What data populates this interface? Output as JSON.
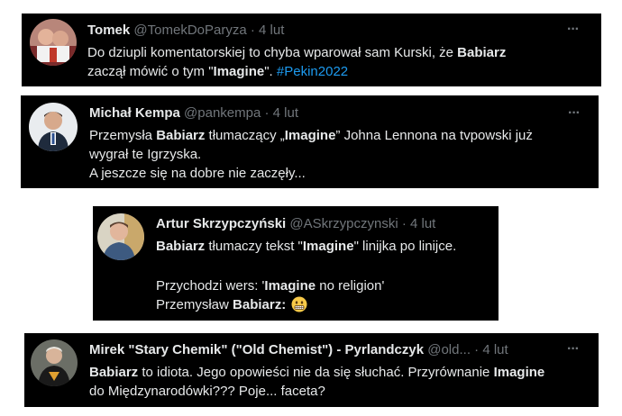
{
  "tweets": [
    {
      "name": "Tomek",
      "handle": "@TomekDoParyza",
      "dot": "·",
      "time": "4 lut",
      "more": "···",
      "line1": {
        "a": "Do dziupli komentatorskiej to chyba wparował sam Kurski, że ",
        "b": "Babiarz"
      },
      "line2": {
        "a": "zaczął mówić o tym \"",
        "b": "Imagine",
        "c": "\". ",
        "hashtag": "#Pekin2022"
      }
    },
    {
      "name": "Michał Kempa",
      "handle": "@pankempa",
      "dot": "·",
      "time": "4 lut",
      "more": "···",
      "line1": {
        "a": "Przemysła ",
        "b": "Babiarz",
        "c": " tłumaczący „",
        "d": "Imagine",
        "e": "” Johna Lennona na tvpowski już"
      },
      "line2": "wygrał te Igrzyska.",
      "line3": "A jeszcze się na dobre nie zaczęły..."
    },
    {
      "name": "Artur Skrzypczyński",
      "handle": "@ASkrzypczynski",
      "dot": "·",
      "time": "4 lut",
      "line1": {
        "b": "Babiarz",
        "a": " tłumaczy tekst \"",
        "d": "Imagine",
        "c": "\" linijka po linijce."
      },
      "line2": {
        "a": "Przychodzi wers: '",
        "b": "Imagine",
        "c": " no religion'"
      },
      "line3": {
        "a": "Przemysław ",
        "b": "Babiarz:",
        "emoji": "grimacing-face"
      }
    },
    {
      "name": "Mirek \"Stary Chemik\" (\"Old Chemist\") - Pyrlandczyk",
      "handle": "@old...",
      "dot": "·",
      "time": "4 lut",
      "more": "···",
      "line1": {
        "b": "Babiarz",
        "a": " to idiota. Jego opowieści nie da się słuchać. Przyrównanie ",
        "d": "Imagine"
      },
      "line2": "do Międzynarodówki??? Poje... faceta?"
    }
  ],
  "colors": {
    "card": "#000000",
    "text": "#e7e9ea",
    "muted": "#71767b",
    "hashtag": "#1d9bf0"
  }
}
